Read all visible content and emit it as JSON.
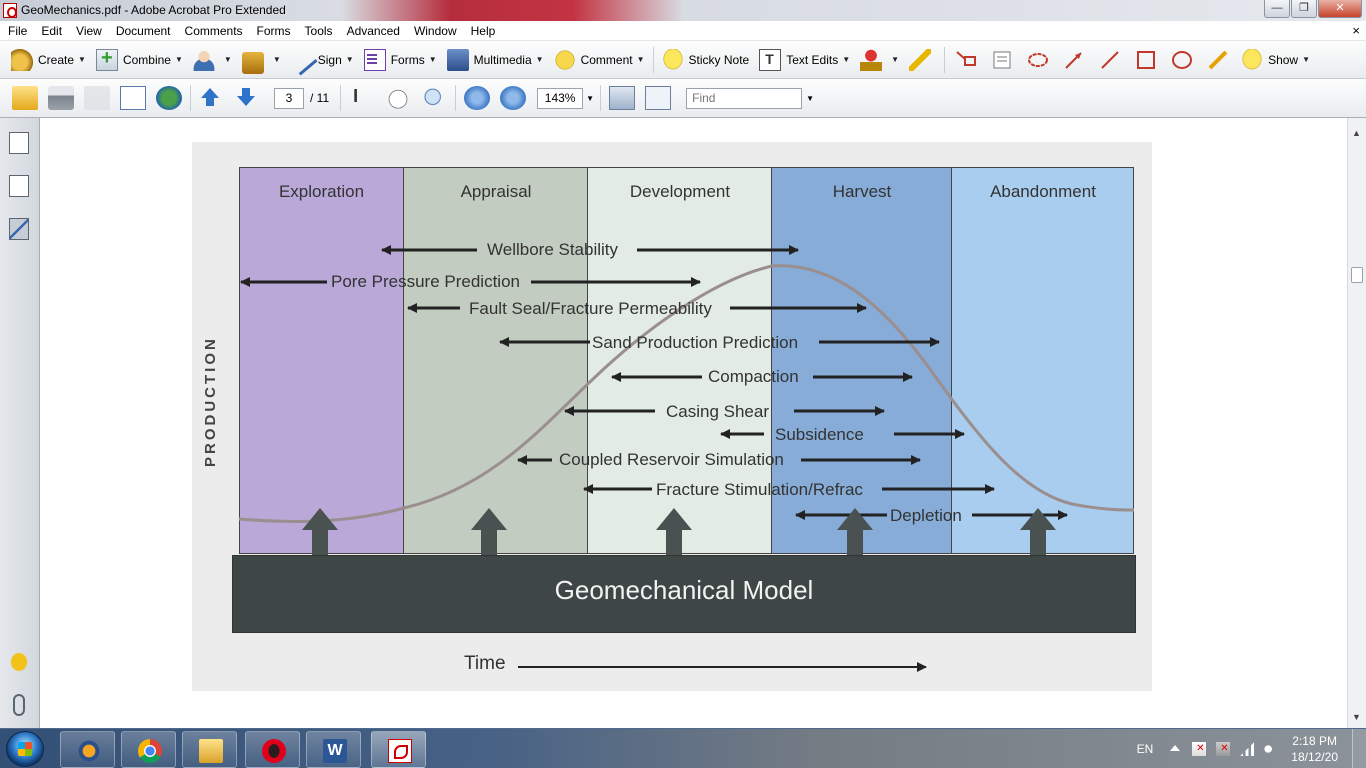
{
  "window": {
    "title": "GeoMechanics.pdf - Adobe Acrobat Pro Extended",
    "minimize_glyph": "—",
    "maximize_glyph": "❐",
    "close_glyph": "✕"
  },
  "menu": {
    "items": [
      "File",
      "Edit",
      "View",
      "Document",
      "Comments",
      "Forms",
      "Tools",
      "Advanced",
      "Window",
      "Help"
    ],
    "doc_close_glyph": "×"
  },
  "toolbar1": {
    "create": "Create",
    "combine": "Combine",
    "sign": "Sign",
    "forms": "Forms",
    "multimedia": "Multimedia",
    "comment": "Comment",
    "sticky_note": "Sticky Note",
    "text_edits": "Text Edits",
    "show": "Show",
    "dropdown_glyph": "▼"
  },
  "toolbar2": {
    "current_page": "3",
    "page_total": "/ 11",
    "zoom": "143%",
    "find_placeholder": "Find",
    "dropdown_glyph": "▼"
  },
  "scrollbar": {
    "up_glyph": "▲",
    "down_glyph": "▼"
  },
  "figure": {
    "phases": [
      "Exploration",
      "Appraisal",
      "Development",
      "Harvest",
      "Abandonment"
    ],
    "y_axis_label": "PRODUCTION",
    "x_axis_label": "Time",
    "base_label": "Geomechanical Model",
    "arrows": [
      {
        "label": "Wellbore Stability"
      },
      {
        "label": "Pore Pressure Prediction"
      },
      {
        "label": "Fault Seal/Fracture Permeability"
      },
      {
        "label": "Sand Production Prediction"
      },
      {
        "label": "Compaction"
      },
      {
        "label": "Casing Shear"
      },
      {
        "label": "Subsidence"
      },
      {
        "label": "Coupled Reservoir Simulation"
      },
      {
        "label": "Fracture Stimulation/Refrac"
      },
      {
        "label": "Depletion"
      }
    ],
    "colors": {
      "exploration": "#b9a8d8",
      "appraisal": "#c3ccc0",
      "development": "#e2ece4",
      "harvest": "#86acd7",
      "abandonment": "#a9cdef",
      "model": "#3f4646",
      "curve": "#9a8e8e"
    }
  },
  "taskbar": {
    "language": "EN",
    "time": "2:18 PM",
    "date": "18/12/20",
    "word_letter": "W"
  }
}
